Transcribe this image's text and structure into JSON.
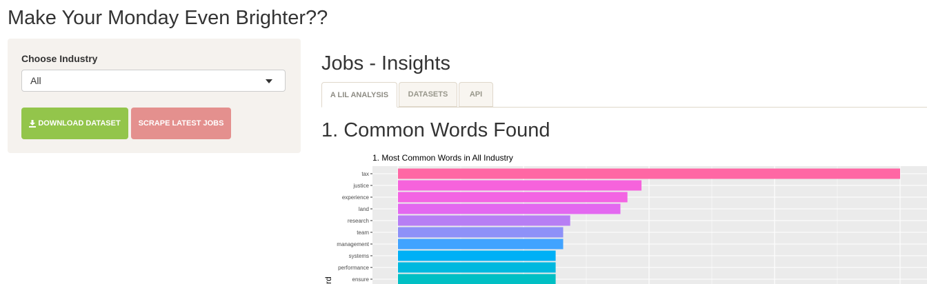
{
  "app": {
    "title": "Make Your Monday Even Brighter??"
  },
  "sidebar": {
    "industry_label": "Choose Industry",
    "industry_selected": "All",
    "download_button": "DOWNLOAD DATASET",
    "scrape_button": "SCRAPE LATEST JOBS"
  },
  "main": {
    "title": "Jobs - Insights",
    "tabs": [
      {
        "label": "A LIL ANALYSIS",
        "active": true
      },
      {
        "label": "DATASETS",
        "active": false
      },
      {
        "label": "API",
        "active": false
      }
    ],
    "section_title": "1. Common Words Found"
  },
  "colors": {
    "download_button": "#93c54b",
    "scrape_button": "#e4908e",
    "sidebar_bg": "#f5f2ee",
    "panel_bg": "#ebebeb"
  },
  "chart_data": {
    "type": "bar",
    "orientation": "horizontal",
    "title": "1. Most Common Words in All Industry",
    "ylabel": "rd",
    "categories": [
      "tax",
      "justice",
      "experience",
      "land",
      "research",
      "team",
      "management",
      "systems",
      "performance",
      "ensure"
    ],
    "values": [
      100,
      48.5,
      45.7,
      44.3,
      34.3,
      32.9,
      32.9,
      31.4,
      31.4,
      31.4
    ],
    "colors": [
      "#ff67a4",
      "#f663dc",
      "#f364e3",
      "#e368f0",
      "#b77ef4",
      "#8e91f8",
      "#41a3ff",
      "#00b0f6",
      "#00b8df",
      "#00bfc4"
    ],
    "grid": true
  }
}
